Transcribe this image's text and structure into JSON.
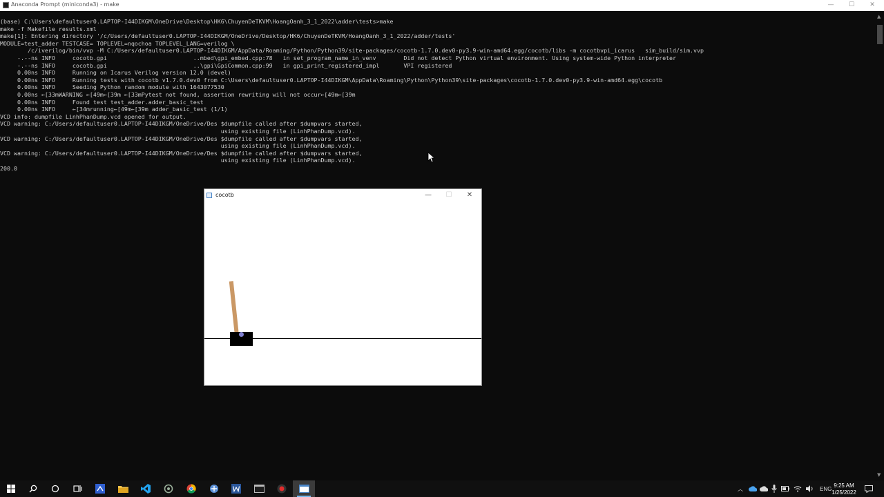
{
  "window": {
    "title": "Anaconda Prompt (miniconda3) - make",
    "controls": {
      "minimize": "—",
      "maximize": "☐",
      "close": "✕"
    }
  },
  "terminal": {
    "lines": [
      "(base) C:\\Users\\defaultuser0.LAPTOP-I44DIKGM\\OneDrive\\Desktop\\HK6\\ChuyenDeTKVM\\HoangOanh_3_1_2022\\adder\\tests>make",
      "make -f Makefile results.xml",
      "make[1]: Entering directory '/c/Users/defaultuser0.LAPTOP-I44DIKGM/OneDrive/Desktop/HK6/ChuyenDeTKVM/HoangOanh_3_1_2022/adder/tests'",
      "MODULE=test_adder TESTCASE= TOPLEVEL=nqochoa TOPLEVEL_LANG=verilog \\",
      "        /c/iverilog/bin/vvp -M C:/Users/defaultuser0.LAPTOP-I44DIKGM/AppData/Roaming/Python/Python39/site-packages/cocotb-1.7.0.dev0-py3.9-win-amd64.egg/cocotb/libs -m cocotbvpi_icarus   sim_build/sim.vvp",
      "     -.--ns INFO     cocotb.gpi                         ..mbed\\gpi_embed.cpp:78   in set_program_name_in_venv        Did not detect Python virtual environment. Using system-wide Python interpreter",
      "     -.--ns INFO     cocotb.gpi                         ..\\gpi\\GpiCommon.cpp:99   in gpi_print_registered_impl       VPI registered",
      "     0.00ns INFO     Running on Icarus Verilog version 12.0 (devel)",
      "     0.00ns INFO     Running tests with cocotb v1.7.0.dev0 from C:\\Users\\defaultuser0.LAPTOP-I44DIKGM\\AppData\\Roaming\\Python\\Python39\\site-packages\\cocotb-1.7.0.dev0-py3.9-win-amd64.egg\\cocotb",
      "     0.00ns INFO     Seeding Python random module with 1643077530",
      "     0.00ns ←[33mWARNING ←[49m←[39m ←[33mPytest not found, assertion rewriting will not occur←[49m←[39m",
      "     0.00ns INFO     Found test test_adder.adder_basic_test",
      "     0.00ns INFO     ←[34mrunning←[49m←[39m adder_basic_test (1/1)",
      "VCD info: dumpfile LinhPhanDump.vcd opened for output.",
      "VCD warning: C:/Users/defaultuser0.LAPTOP-I44DIKGM/OneDrive/Des $dumpfile called after $dumpvars started,",
      "                                                                using existing file (LinhPhanDump.vcd).",
      "VCD warning: C:/Users/defaultuser0.LAPTOP-I44DIKGM/OneDrive/Des $dumpfile called after $dumpvars started,",
      "                                                                using existing file (LinhPhanDump.vcd).",
      "VCD warning: C:/Users/defaultuser0.LAPTOP-I44DIKGM/OneDrive/Des $dumpfile called after $dumpvars started,",
      "                                                                using existing file (LinhPhanDump.vcd).",
      "",
      "200.0"
    ]
  },
  "cocotb_window": {
    "title": "cocotb",
    "controls": {
      "minimize": "—",
      "maximize": "☐",
      "close": "✕"
    }
  },
  "cartpole": {
    "pole_angle_deg": -6
  },
  "taskbar": {
    "icons": [
      "windows-start-icon",
      "search-icon",
      "cortana-icon",
      "task-view-icon",
      "visual-studio-icon",
      "file-explorer-icon",
      "vscode-icon",
      "app-icon",
      "chrome-icon",
      "app-icon-2",
      "word-icon",
      "terminal-icon",
      "recorder-icon",
      "active-window-icon"
    ],
    "language": "ENG",
    "time": "9:25 AM",
    "date": "1/25/2022"
  },
  "colors": {
    "terminal_bg": "#0c0c0c",
    "terminal_text": "#cccccc",
    "pole": "#ca9865",
    "axle": "#8080d0",
    "taskbar_bg": "#101010"
  }
}
